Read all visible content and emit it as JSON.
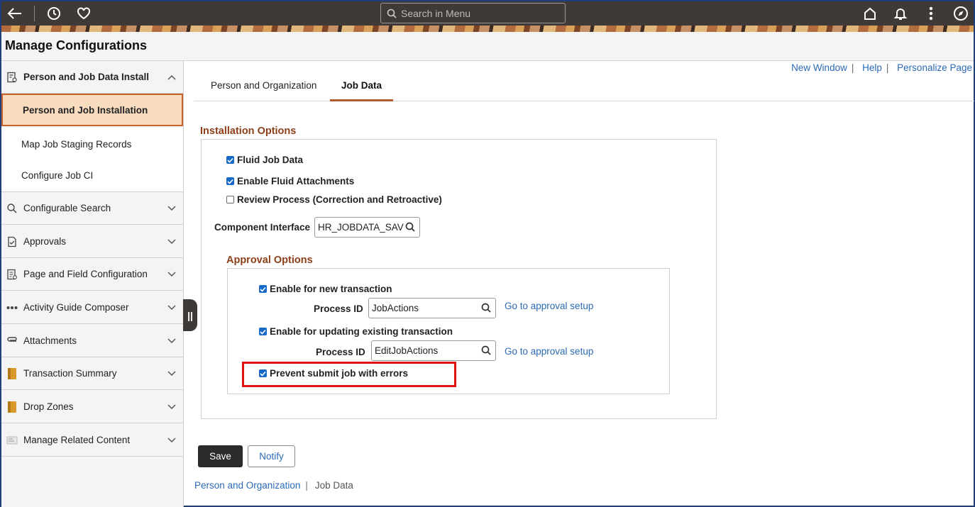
{
  "topbar": {
    "search_placeholder": "Search in Menu"
  },
  "page": {
    "title": "Manage Configurations"
  },
  "sidebar": {
    "groups": [
      {
        "label": "Person and Job Data Install",
        "icon": "document-gear-icon",
        "expanded": true
      },
      {
        "label": "Configurable Search",
        "icon": "search-gear-icon"
      },
      {
        "label": "Approvals",
        "icon": "approval-doc-icon"
      },
      {
        "label": "Page and Field Configuration",
        "icon": "page-config-icon"
      },
      {
        "label": "Activity Guide Composer",
        "icon": "dots-icon"
      },
      {
        "label": "Attachments",
        "icon": "paperclip-icon"
      },
      {
        "label": "Transaction Summary",
        "icon": "folder-icon"
      },
      {
        "label": "Drop Zones",
        "icon": "folder-icon"
      },
      {
        "label": "Manage Related Content",
        "icon": "related-content-icon"
      }
    ],
    "subitems": [
      {
        "label": "Person and Job Installation",
        "active": true
      },
      {
        "label": "Map Job Staging Records"
      },
      {
        "label": "Configure Job CI"
      }
    ]
  },
  "toplinks": {
    "new_window": "New Window",
    "help": "Help",
    "personalize": "Personalize Page"
  },
  "tabs": [
    {
      "label": "Person and Organization",
      "selected": false
    },
    {
      "label": "Job Data",
      "selected": true
    }
  ],
  "installation": {
    "title": "Installation Options",
    "fluid_job_data": {
      "label": "Fluid Job Data",
      "checked": true
    },
    "fluid_attachments": {
      "label": "Enable Fluid Attachments",
      "checked": true
    },
    "review_process": {
      "label": "Review Process (Correction and Retroactive)",
      "checked": false
    },
    "component_interface_label": "Component Interface",
    "component_interface_value": "HR_JOBDATA_SAV"
  },
  "approval": {
    "title": "Approval Options",
    "new_txn": {
      "label": "Enable for new transaction",
      "checked": true
    },
    "process_id_label": "Process ID",
    "new_process_id": "JobActions",
    "goto_link": "Go to approval setup",
    "update_txn": {
      "label": "Enable for updating existing transaction",
      "checked": true
    },
    "update_process_id": "EditJobActions",
    "prevent_submit": {
      "label": "Prevent submit job with errors",
      "checked": true
    }
  },
  "buttons": {
    "save": "Save",
    "notify": "Notify"
  },
  "bottom_links": {
    "person_org": "Person and Organization",
    "job_data": "Job Data"
  },
  "colors": {
    "topbar": "#3f3a37",
    "accent": "#b35a2a",
    "section_title": "#8e3f1a",
    "link": "#2a6ab5",
    "checkbox": "#1769c7",
    "highlight": "#e01111"
  }
}
